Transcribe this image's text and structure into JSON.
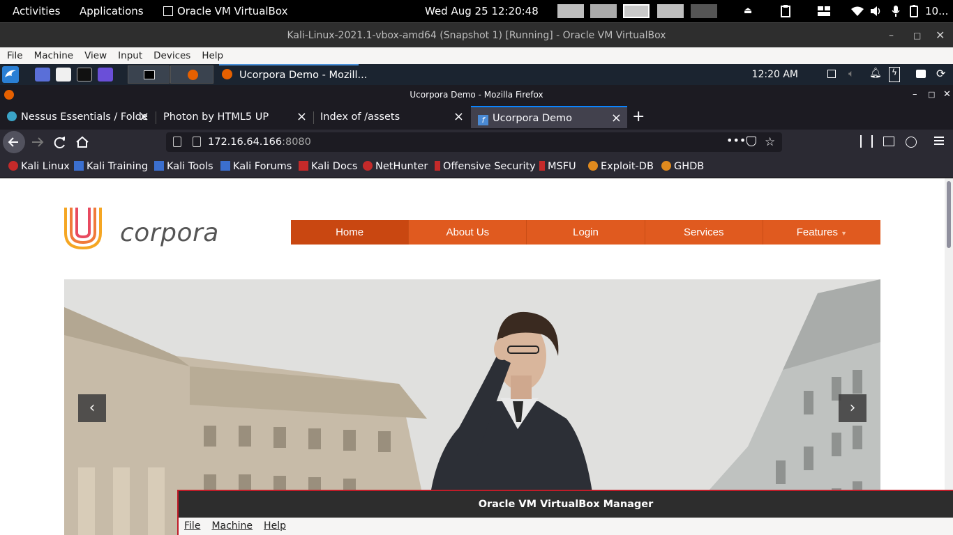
{
  "gnome": {
    "activities": "Activities",
    "applications": "Applications",
    "app_name": "Oracle VM VirtualBox",
    "datetime": "Wed Aug 25  12:20:48",
    "battery": "10..."
  },
  "vbox": {
    "title": "Kali-Linux-2021.1-vbox-amd64 (Snapshot 1) [Running] - Oracle VM VirtualBox",
    "menu": [
      "File",
      "Machine",
      "View",
      "Input",
      "Devices",
      "Help"
    ]
  },
  "kali_panel": {
    "task_title": "Ucorpora Demo - Mozill...",
    "clock": "12:20 AM"
  },
  "firefox": {
    "window_title": "Ucorpora Demo - Mozilla Firefox",
    "tabs": [
      {
        "label": "Nessus Essentials / Folde"
      },
      {
        "label": "Photon by HTML5 UP"
      },
      {
        "label": "Index of /assets"
      },
      {
        "label": "Ucorpora Demo"
      }
    ],
    "url_host": "172.16.64.166",
    "url_port": ":8080",
    "bookmarks": [
      "Kali Linux",
      "Kali Training",
      "Kali Tools",
      "Kali Forums",
      "Kali Docs",
      "NetHunter",
      "Offensive Security",
      "MSFU",
      "Exploit-DB",
      "GHDB"
    ]
  },
  "site": {
    "logo_text": "corpora",
    "nav": [
      "Home",
      "About Us",
      "Login",
      "Services",
      "Features"
    ],
    "accent_color": "#e05a1f"
  },
  "vbox_manager": {
    "title": "Oracle VM VirtualBox Manager",
    "menu": [
      "File",
      "Machine",
      "Help"
    ]
  }
}
